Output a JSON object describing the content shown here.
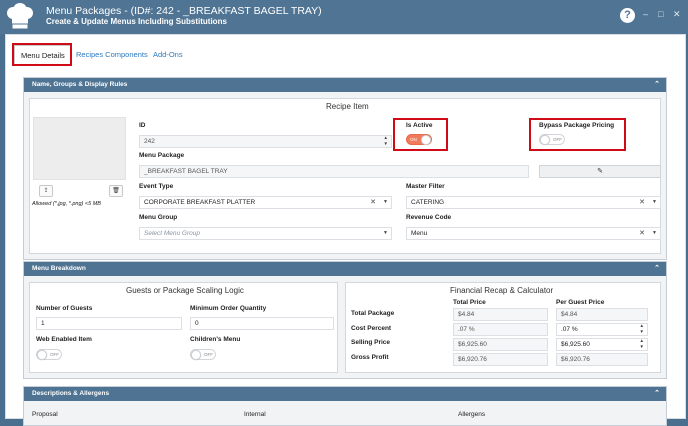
{
  "window": {
    "title": "Menu Packages - (ID#: 242 - _BREAKFAST BAGEL TRAY)",
    "subtitle": "Create & Update Menus Including Substitutions",
    "help": "?",
    "minimize": "–",
    "maximize": "□",
    "close": "✕"
  },
  "tabs": [
    "Menu Details",
    "Recipes Components",
    "Add-Ons"
  ],
  "sections": {
    "name_groups": {
      "header": "Name, Groups & Display Rules",
      "panel_title": "Recipe Item",
      "id_label": "ID",
      "id_value": "242",
      "menu_package_label": "Menu Package",
      "menu_package_value": "_BREAKFAST BAGEL TRAY",
      "is_active_label": "Is Active",
      "is_active_state": "ON",
      "bypass_label": "Bypass Package Pricing",
      "bypass_state": "OFF",
      "image_hint": "Allowed (*.jpg, *.png) <5 MB",
      "event_type_label": "Event Type",
      "event_type_value": "CORPORATE BREAKFAST PLATTER",
      "master_filter_label": "Master Filter",
      "master_filter_value": "CATERING",
      "menu_group_label": "Menu Group",
      "menu_group_placeholder": "Select Menu Group",
      "revenue_code_label": "Revenue Code",
      "revenue_code_value": "Menu"
    },
    "breakdown": {
      "header": "Menu Breakdown",
      "scaling_title": "Guests or Package Scaling Logic",
      "guests_label": "Number of Guests",
      "guests_value": "1",
      "min_order_label": "Minimum Order Quantity",
      "min_order_value": "0",
      "web_enabled_label": "Web Enabled Item",
      "web_enabled_state": "OFF",
      "childrens_label": "Children's Menu",
      "childrens_state": "OFF",
      "recap_title": "Financial Recap & Calculator",
      "col_total": "Total Price",
      "col_per_guest": "Per Guest Price",
      "rows": [
        {
          "label": "Total Package",
          "total": "$4.84",
          "per_guest": "$4.84"
        },
        {
          "label": "Cost Percent",
          "total": ".07 %",
          "per_guest": ".07 %"
        },
        {
          "label": "Selling Price",
          "total": "$6,925.60",
          "per_guest": "$6,925.60"
        },
        {
          "label": "Gross Profit",
          "total": "$6,920.76",
          "per_guest": "$6,920.76"
        }
      ]
    },
    "descriptions": {
      "header": "Descriptions & Allergens",
      "cols": [
        "Proposal",
        "Internal",
        "Allergens"
      ]
    }
  },
  "colors": {
    "titlebar": "#4f7494",
    "section_header": "#4e7393",
    "toggle_on": "#f07b5c",
    "highlight": "#d00a16"
  }
}
